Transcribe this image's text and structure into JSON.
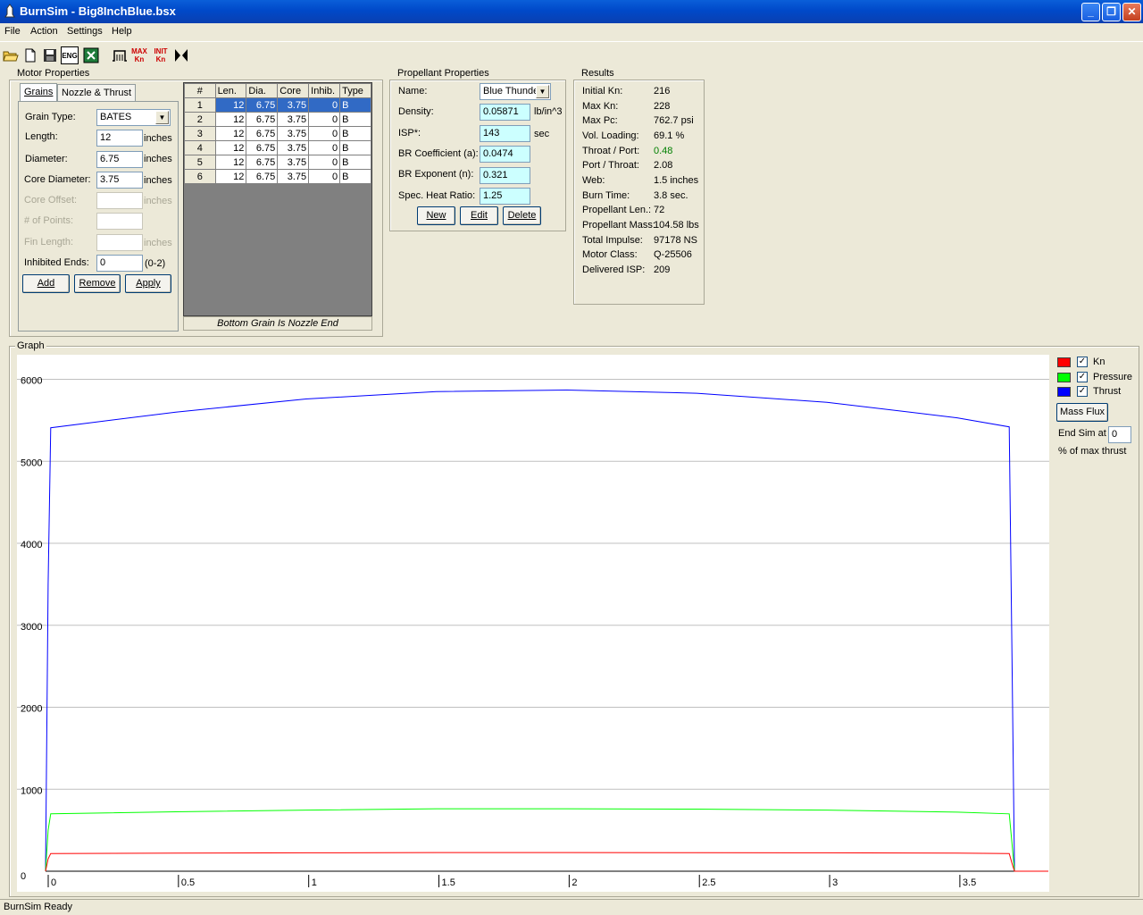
{
  "window": {
    "title": "BurnSim - Big8InchBlue.bsx",
    "minimize": "_",
    "restore": "❐",
    "close": "✕"
  },
  "menu": [
    "File",
    "Action",
    "Settings",
    "Help"
  ],
  "toolbar": [
    "open-icon",
    "new-icon",
    "save-icon",
    "ENG",
    "excel-icon",
    "thrust-icon",
    "Max Kn",
    "INIT Kn",
    "nozzle-icon"
  ],
  "toolbar_labels": {
    "eng": "ENG",
    "maxkn": "MAX Kn",
    "initkn": "INIT Kn"
  },
  "motor": {
    "group_label": "Motor Properties",
    "tabs": [
      "Grains",
      "Nozzle & Thrust"
    ],
    "grain_type_label": "Grain Type:",
    "grain_type": "BATES",
    "length_label": "Length:",
    "length": "12",
    "length_unit": "inches",
    "diameter_label": "Diameter:",
    "diameter": "6.75",
    "diameter_unit": "inches",
    "core_label": "Core Diameter:",
    "core": "3.75",
    "core_unit": "inches",
    "offset_label": "Core Offset:",
    "offset_unit": "inches",
    "points_label": "# of Points:",
    "fin_label": "Fin Length:",
    "fin_unit": "inches",
    "inhibited_label": "Inhibited Ends:",
    "inhibited": "0",
    "inhibited_range": "(0-2)",
    "add": "Add",
    "remove": "Remove",
    "apply": "Apply"
  },
  "grains": {
    "headers": [
      "#",
      "Len.",
      "Dia.",
      "Core",
      "Inhib.",
      "Type"
    ],
    "rows": [
      [
        "1",
        "12",
        "6.75",
        "3.75",
        "0",
        "B"
      ],
      [
        "2",
        "12",
        "6.75",
        "3.75",
        "0",
        "B"
      ],
      [
        "3",
        "12",
        "6.75",
        "3.75",
        "0",
        "B"
      ],
      [
        "4",
        "12",
        "6.75",
        "3.75",
        "0",
        "B"
      ],
      [
        "5",
        "12",
        "6.75",
        "3.75",
        "0",
        "B"
      ],
      [
        "6",
        "12",
        "6.75",
        "3.75",
        "0",
        "B"
      ]
    ],
    "footer": "Bottom Grain Is Nozzle End"
  },
  "propellant": {
    "group_label": "Propellant Properties",
    "name_label": "Name:",
    "name": "Blue Thunde",
    "density_label": "Density:",
    "density": "0.05871",
    "density_unit": "lb/in^3",
    "isp_label": "ISP*:",
    "isp": "143",
    "isp_unit": "sec",
    "brc_label": "BR Coefficient (a):",
    "brc": "0.0474",
    "bre_label": "BR Exponent (n):",
    "bre": "0.321",
    "shr_label": "Spec. Heat Ratio:",
    "shr": "1.25",
    "new": "New",
    "edit": "Edit",
    "delete": "Delete"
  },
  "results": {
    "group_label": "Results",
    "items": [
      {
        "label": "Initial Kn:",
        "value": "216"
      },
      {
        "label": "Max Kn:",
        "value": "228"
      },
      {
        "label": "Max Pc:",
        "value": "762.7 psi"
      },
      {
        "label": "Vol. Loading:",
        "value": "69.1 %"
      },
      {
        "label": "Throat / Port:",
        "value": "0.48"
      },
      {
        "label": "Port / Throat:",
        "value": "2.08"
      },
      {
        "label": "Web:",
        "value": "1.5 inches"
      },
      {
        "label": "Burn Time:",
        "value": "3.8 sec."
      },
      {
        "label": "Propellant Len.:",
        "value": "72"
      },
      {
        "label": "Propellant Mass:",
        "value": "104.58 lbs"
      },
      {
        "label": "Total Impulse:",
        "value": "97178 NS"
      },
      {
        "label": "Motor Class:",
        "value": "Q-25506"
      },
      {
        "label": "Delivered ISP:",
        "value": "209"
      }
    ],
    "throat_port_color": "#008000"
  },
  "graph": {
    "group_label": "Graph",
    "legend": [
      {
        "name": "Kn",
        "color": "#ff0000",
        "checked": true
      },
      {
        "name": "Pressure",
        "color": "#00ff00",
        "checked": true
      },
      {
        "name": "Thrust",
        "color": "#0000ff",
        "checked": true
      }
    ],
    "mass_flux": "Mass Flux",
    "end_sim_label": "End Sim at",
    "end_sim_value": "0",
    "end_sim_unit": "% of max thrust"
  },
  "chart_data": {
    "type": "line",
    "xlim": [
      0,
      3.85
    ],
    "ylim": [
      0,
      6300
    ],
    "xticks": [
      0,
      0.5,
      1,
      1.5,
      2,
      2.5,
      3,
      3.5
    ],
    "xtick_labels": [
      "0",
      "0.5",
      "1",
      "1.5",
      "2",
      "2.5",
      "3",
      "3.5"
    ],
    "yticks": [
      0,
      1000,
      2000,
      3000,
      4000,
      5000,
      6000
    ],
    "ytick_labels": [
      "0",
      "1000",
      "2000",
      "3000",
      "4000",
      "5000",
      "6000"
    ],
    "grid": true,
    "series": [
      {
        "name": "Thrust",
        "color": "#0000ff",
        "x": [
          0,
          0.01,
          0.02,
          0.5,
          1.0,
          1.5,
          2.0,
          2.5,
          3.0,
          3.5,
          3.7,
          3.71,
          3.72,
          3.85
        ],
        "y": [
          0,
          3500,
          5410,
          5600,
          5760,
          5850,
          5870,
          5830,
          5720,
          5530,
          5420,
          2700,
          0,
          0
        ]
      },
      {
        "name": "Pressure",
        "color": "#00ff00",
        "x": [
          0,
          0.01,
          0.02,
          0.5,
          1.0,
          1.5,
          2.0,
          2.5,
          3.0,
          3.5,
          3.7,
          3.71,
          3.72,
          3.85
        ],
        "y": [
          0,
          500,
          700,
          725,
          745,
          762,
          762,
          758,
          745,
          720,
          700,
          350,
          0,
          0
        ]
      },
      {
        "name": "Kn",
        "color": "#ff0000",
        "x": [
          0,
          0.01,
          0.02,
          0.5,
          1.0,
          1.5,
          2.0,
          2.5,
          3.0,
          3.5,
          3.7,
          3.71,
          3.72,
          3.85
        ],
        "y": [
          0,
          150,
          216,
          220,
          225,
          228,
          228,
          227,
          224,
          220,
          216,
          100,
          0,
          0
        ]
      }
    ]
  },
  "status": "BurnSim Ready"
}
